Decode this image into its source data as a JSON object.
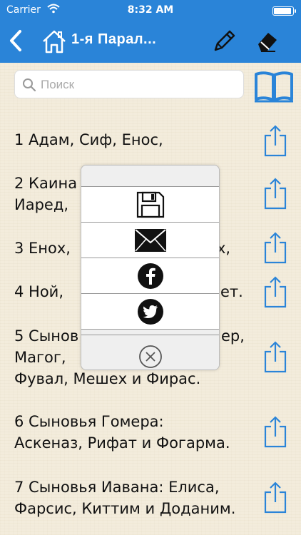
{
  "status": {
    "carrier": "Carrier",
    "time": "8:32 AM"
  },
  "nav": {
    "title": "1-я Парал..."
  },
  "search": {
    "placeholder": "Поиск"
  },
  "verses": [
    {
      "l1": "1 Адам, Сиф, Енос,",
      "l2": ""
    },
    {
      "l1": "2 Каина",
      "l2": "Иаред,"
    },
    {
      "l1": "3 Енох,",
      "l2": ""
    },
    {
      "l1": "4 Ной,",
      "l2": ""
    },
    {
      "l1": "5 Сынов",
      "l2": "Магог,",
      "l3": "Фувал, Мешех и Фирас."
    },
    {
      "l1": "6 Сыновья Гомера:",
      "l2": "Аскеназ, Рифат и Фогарма."
    },
    {
      "l1": "7 Сыновья Иавана: Елиса,",
      "l2": "Фарсис, Киттим и Доданим."
    }
  ],
  "verse_tails": {
    "v3": "х,",
    "v4": "ет.",
    "v5": "ер,"
  },
  "popup": {
    "icons": [
      "save-icon",
      "mail-icon",
      "facebook-icon",
      "twitter-icon",
      "close-circle-icon"
    ]
  },
  "colors": {
    "header": "#2a84d8",
    "accent": "#2a84d8",
    "background": "#f3ecdc"
  }
}
